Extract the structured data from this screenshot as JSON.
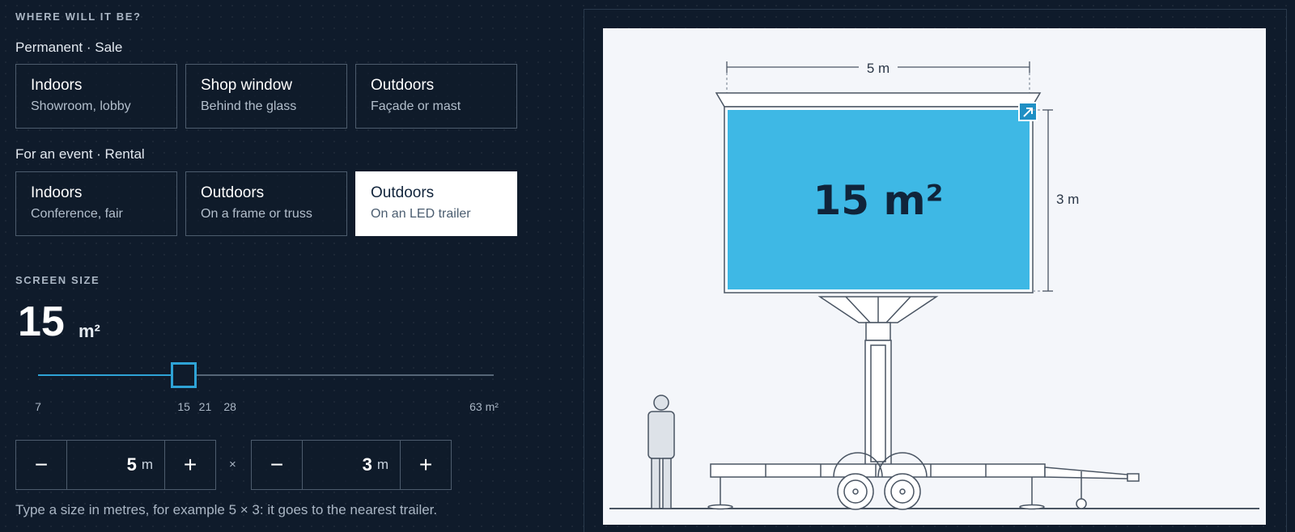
{
  "location": {
    "heading": "WHERE WILL IT BE?",
    "permanent": {
      "label": "Permanent · Sale",
      "options": [
        {
          "title": "Indoors",
          "subtitle": "Showroom, lobby"
        },
        {
          "title": "Shop window",
          "subtitle": "Behind the glass"
        },
        {
          "title": "Outdoors",
          "subtitle": "Façade or mast"
        }
      ]
    },
    "event": {
      "label": "For an event · Rental",
      "options": [
        {
          "title": "Indoors",
          "subtitle": "Conference, fair"
        },
        {
          "title": "Outdoors",
          "subtitle": "On a frame or truss"
        },
        {
          "title": "Outdoors",
          "subtitle": "On an LED trailer",
          "selected": true
        }
      ]
    }
  },
  "size": {
    "heading": "SCREEN SIZE",
    "value": "15",
    "unit": "m²",
    "slider": {
      "min": 7,
      "max": 63,
      "value": 15,
      "fill_fraction": 0.32
    },
    "ticks": [
      {
        "label": "7",
        "value": 7
      },
      {
        "label": "15",
        "value": 15
      },
      {
        "label": "21",
        "value": 21
      },
      {
        "label": "28",
        "value": 28
      },
      {
        "label": "63 m²",
        "value": 63
      }
    ],
    "width": {
      "value": "5",
      "unit": "m",
      "minus": "−",
      "plus": "+"
    },
    "height": {
      "value": "3",
      "unit": "m",
      "minus": "−",
      "plus": "+"
    },
    "times": "×",
    "hint": "Type a size in metres, for example 5 × 3: it goes to the nearest trailer."
  },
  "preview": {
    "width_label": "5 m",
    "height_label": "3 m",
    "area_label": "15 m²",
    "screen_color": "#3eb8e5",
    "accent_color": "#1f8fc4",
    "icons": [
      "expand-arrow-icon",
      "person-figure",
      "led-trailer"
    ]
  }
}
